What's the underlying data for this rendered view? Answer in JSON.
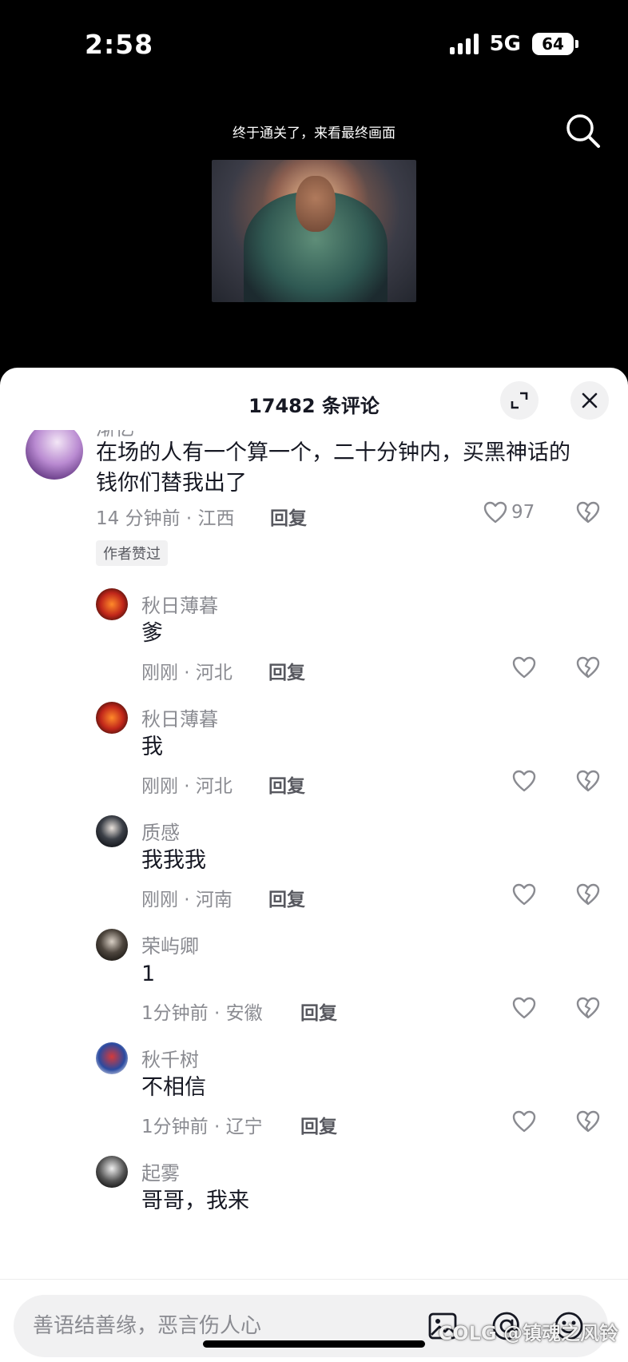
{
  "status_bar": {
    "time": "2:58",
    "network": "5G",
    "battery": "64"
  },
  "video": {
    "caption": "终于通关了，来看最终画面"
  },
  "sheet": {
    "title": "17482 条评论"
  },
  "comments": [
    {
      "username": "渐忆",
      "text": "在场的人有一个算一个，二十分钟内，买黑神话的钱你们替我出了",
      "meta": "14 分钟前 · 江西",
      "reply": "回复",
      "likes": "97",
      "badge": "作者赞过"
    },
    {
      "username": "秋日薄暮",
      "text": "爹",
      "meta": "刚刚 · 河北",
      "reply": "回复"
    },
    {
      "username": "秋日薄暮",
      "text": "我",
      "meta": "刚刚 · 河北",
      "reply": "回复"
    },
    {
      "username": "质感",
      "text": "我我我",
      "meta": "刚刚 · 河南",
      "reply": "回复"
    },
    {
      "username": "荣屿卿",
      "text": "1",
      "meta": "1分钟前 · 安徽",
      "reply": "回复"
    },
    {
      "username": "秋千树",
      "text": "不相信",
      "meta": "1分钟前 · 辽宁",
      "reply": "回复"
    },
    {
      "username": "起雾",
      "text": "哥哥，我来"
    }
  ],
  "input": {
    "placeholder": "善语结善缘，恶言伤人心"
  },
  "watermark": "COLG @镇魂之风铃",
  "colors": {
    "sheet_bg": "#ffffff",
    "text_primary": "#161823",
    "text_secondary": "#8a8b91",
    "input_bg": "#f1f1f2"
  }
}
